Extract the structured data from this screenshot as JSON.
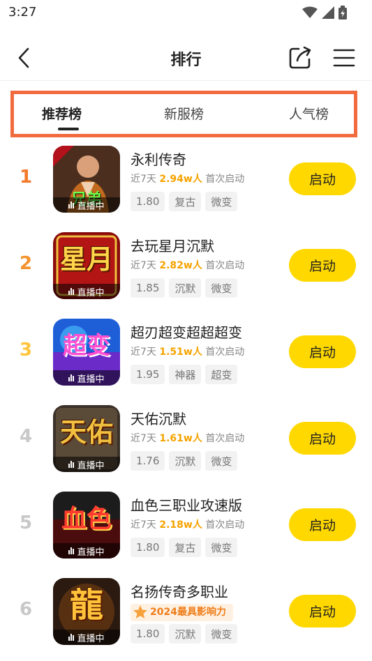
{
  "status_bar": {
    "time": "3:27",
    "icons": [
      "wifi-icon",
      "signal-icon",
      "battery-charging-icon"
    ]
  },
  "header": {
    "title": "排行",
    "back_icon": "chevron-left-icon",
    "share_icon": "share-icon",
    "menu_icon": "menu-icon"
  },
  "tabs": [
    {
      "label": "推荐榜",
      "active": true
    },
    {
      "label": "新服榜",
      "active": false
    },
    {
      "label": "人气榜",
      "active": false
    }
  ],
  "colors": {
    "accent_yellow": "#ffd800",
    "highlight_border": "#f26b3f",
    "rank_1": "#f47a2b",
    "rank_2": "#f5922e",
    "rank_3": "#ffc53d",
    "rank_other": "#c8c8c8",
    "hot_number": "#f5a300"
  },
  "games": [
    {
      "rank": "1",
      "name": "永利传奇",
      "stat_prefix": "近7天",
      "players": "2.94w人",
      "stat_suffix": "首次启动",
      "tags": [
        "1.80",
        "复古",
        "微变"
      ],
      "live_label": "直播中",
      "icon_text": "兄弟",
      "button": "启动"
    },
    {
      "rank": "2",
      "name": "去玩星月沉默",
      "stat_prefix": "近7天",
      "players": "2.82w人",
      "stat_suffix": "首次启动",
      "tags": [
        "1.85",
        "沉默",
        "微变"
      ],
      "live_label": "直播中",
      "icon_text": "星月",
      "button": "启动"
    },
    {
      "rank": "3",
      "name": "超刃超变超超超变",
      "stat_prefix": "近7天",
      "players": "1.51w人",
      "stat_suffix": "首次启动",
      "tags": [
        "1.95",
        "神器",
        "超变"
      ],
      "live_label": "直播中",
      "icon_text": "超变",
      "button": "启动"
    },
    {
      "rank": "4",
      "name": "天佑沉默",
      "stat_prefix": "近7天",
      "players": "1.61w人",
      "stat_suffix": "首次启动",
      "tags": [
        "1.76",
        "沉默",
        "微变"
      ],
      "live_label": "直播中",
      "icon_text": "天佑",
      "button": "启动"
    },
    {
      "rank": "5",
      "name": "血色三职业攻速版",
      "stat_prefix": "近7天",
      "players": "2.18w人",
      "stat_suffix": "首次启动",
      "tags": [
        "1.80",
        "复古",
        "微变"
      ],
      "live_label": "直播中",
      "icon_text": "血色",
      "button": "启动"
    },
    {
      "rank": "6",
      "name": "名扬传奇多职业",
      "award": "2024最具影响力",
      "tags": [
        "1.80",
        "沉默",
        "微变"
      ],
      "live_label": "直播中",
      "icon_text": "龍",
      "button": "启动"
    }
  ]
}
